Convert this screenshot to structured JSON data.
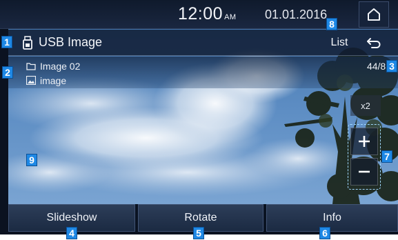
{
  "status_bar": {
    "time": "12:00",
    "ampm": "AM",
    "date": "01.01.2016",
    "home_icon": "home-icon"
  },
  "title_bar": {
    "icon": "usb-drive-icon",
    "title": "USB Image",
    "list_label": "List",
    "back_icon": "back-arrow-icon"
  },
  "info_strip": {
    "folder_icon": "folder-icon",
    "folder_name": "Image 02",
    "image_icon": "image-file-icon",
    "file_name": "image",
    "counter": "44/81"
  },
  "zoom": {
    "level": "x2",
    "zoom_in_label": "+",
    "zoom_out_label": "−"
  },
  "toolbar": {
    "slideshow_label": "Slideshow",
    "rotate_label": "Rotate",
    "info_label": "Info"
  },
  "callouts": {
    "c1": "1",
    "c2": "2",
    "c3": "3",
    "c4": "4",
    "c5": "5",
    "c6": "6",
    "c7": "7",
    "c8": "8",
    "c9": "9"
  },
  "colors": {
    "callout_blue": "#1e88e5",
    "bar_dark": "#0f1a2c",
    "button_top": "#2d3e59",
    "zoom_border": "#9fd8ff"
  }
}
